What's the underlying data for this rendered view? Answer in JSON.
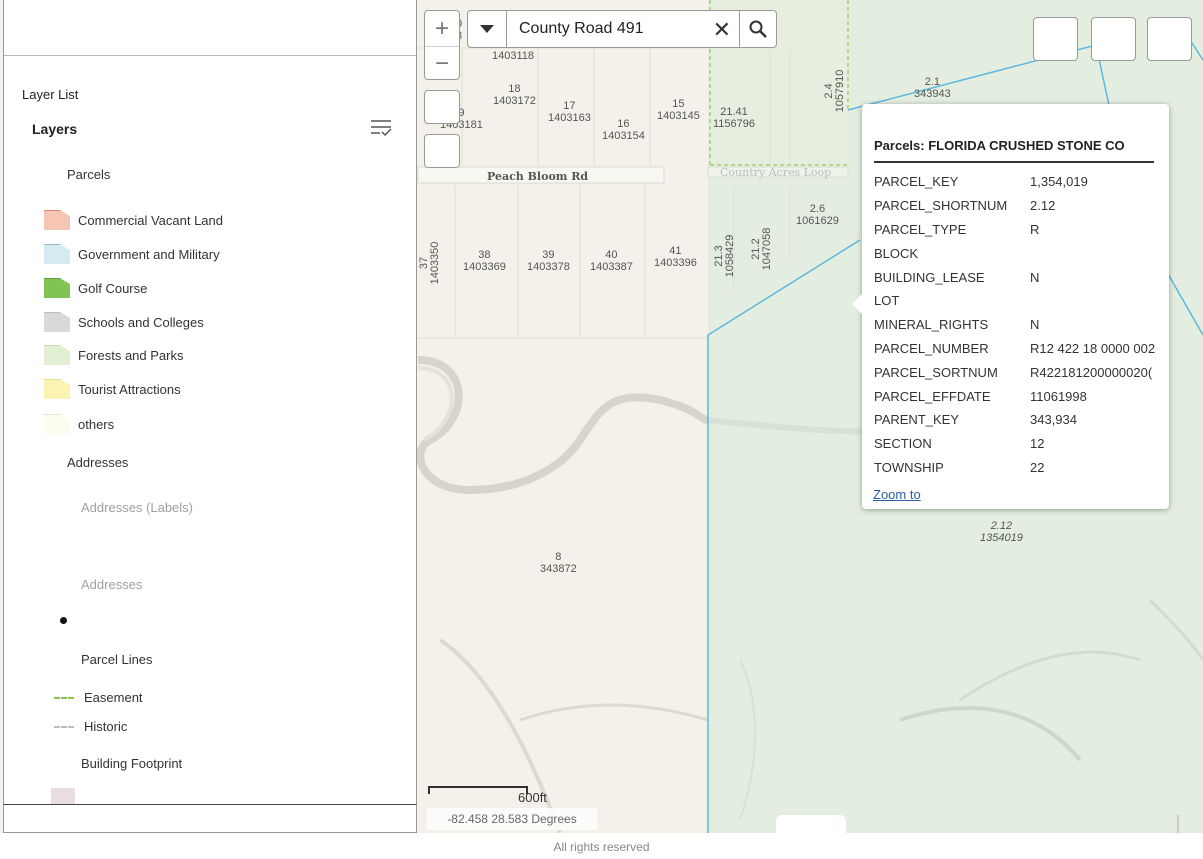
{
  "layer_list": {
    "title": "Layer List",
    "heading": "Layers",
    "parcels_group": "Parcels",
    "parcel_legend": [
      {
        "label": "Commercial Vacant Land",
        "color": "#f6c5b4",
        "border": "#e9836a"
      },
      {
        "label": "Government and Military",
        "color": "#d6eaf2",
        "border": "#8cbcd0"
      },
      {
        "label": "Golf Course",
        "color": "#82c356",
        "border": "#5e9e3a"
      },
      {
        "label": "Schools and Colleges",
        "color": "#d9d9d9",
        "border": "#bdbdbd"
      },
      {
        "label": "Forests and Parks",
        "color": "#e2efd3",
        "border": "#c7dcb1"
      },
      {
        "label": "Tourist Attractions",
        "color": "#fbf3b4",
        "border": "#ebdf8a"
      },
      {
        "label": "others",
        "color": "#fcfcf0",
        "border": "#e6e6d3"
      }
    ],
    "addresses_group": "Addresses",
    "addresses_labels": "Addresses (Labels)",
    "addresses_sub": "Addresses",
    "parcel_lines_group": "Parcel Lines",
    "line_legend": [
      {
        "label": "Easement",
        "color": "#8bc34a"
      },
      {
        "label": "Historic",
        "color": "#bdbdbd"
      }
    ],
    "building_group": "Building Footprint",
    "building_color": "#e8dde2"
  },
  "search": {
    "value": "County Road 491"
  },
  "popup": {
    "title": "Parcels: FLORIDA CRUSHED STONE CO",
    "fields": [
      {
        "key": "PARCEL_KEY",
        "value": "1,354,019"
      },
      {
        "key": "PARCEL_SHORTNUM",
        "value": "2.12"
      },
      {
        "key": "PARCEL_TYPE",
        "value": "R"
      },
      {
        "key": "BLOCK",
        "value": ""
      },
      {
        "key": "BUILDING_LEASE",
        "value": "N"
      },
      {
        "key": "LOT",
        "value": ""
      },
      {
        "key": "MINERAL_RIGHTS",
        "value": "N"
      },
      {
        "key": "PARCEL_NUMBER",
        "value": "R12 422 18 0000 002"
      },
      {
        "key": "PARCEL_SORTNUM",
        "value": "R422181200000020("
      },
      {
        "key": "PARCEL_EFFDATE",
        "value": "11061998"
      },
      {
        "key": "PARENT_KEY",
        "value": "343,934"
      },
      {
        "key": "SECTION",
        "value": "12"
      },
      {
        "key": "TOWNSHIP",
        "value": "22"
      }
    ],
    "zoom_link": "Zoom to"
  },
  "map": {
    "roads": {
      "peach_bloom": "Peach Bloom Rd",
      "country_acres": "Country Acres Loop"
    },
    "parcel_labels": [
      {
        "num": "0",
        "id": "3"
      },
      {
        "num": "",
        "id": "1403118"
      },
      {
        "num": "18",
        "id": "1403172"
      },
      {
        "num": "17",
        "id": "1403163"
      },
      {
        "num": "16",
        "id": "1403154"
      },
      {
        "num": "15",
        "id": "1403145"
      },
      {
        "num": "21.41",
        "id": "1156796"
      },
      {
        "num": "9",
        "id": "1403181"
      },
      {
        "num": "2.1",
        "id": "343943"
      },
      {
        "num": "2.6",
        "id": "1061629"
      },
      {
        "num": "38",
        "id": "1403369"
      },
      {
        "num": "39",
        "id": "1403378"
      },
      {
        "num": "40",
        "id": "1403387"
      },
      {
        "num": "41",
        "id": "1403396"
      },
      {
        "num": "8",
        "id": "343872"
      },
      {
        "num": "2.12",
        "id": "1354019"
      }
    ],
    "rotated_labels": [
      {
        "num": "2.4",
        "id": "1057910"
      },
      {
        "num": "37",
        "id": "1403350"
      },
      {
        "num": "21.3",
        "id": "1058429"
      },
      {
        "num": "21.2",
        "id": "1047058"
      }
    ],
    "scale_label": "600ft",
    "coordinates": "-82.458 28.583 Degrees",
    "copyright": "All rights reserved"
  },
  "colors": {
    "map_bg": "#f3f1ea",
    "green_area": "#e3eee0",
    "parcel_line": "#5cb8e0",
    "easement": "#8bc34a",
    "link": "#2a5fa5"
  }
}
